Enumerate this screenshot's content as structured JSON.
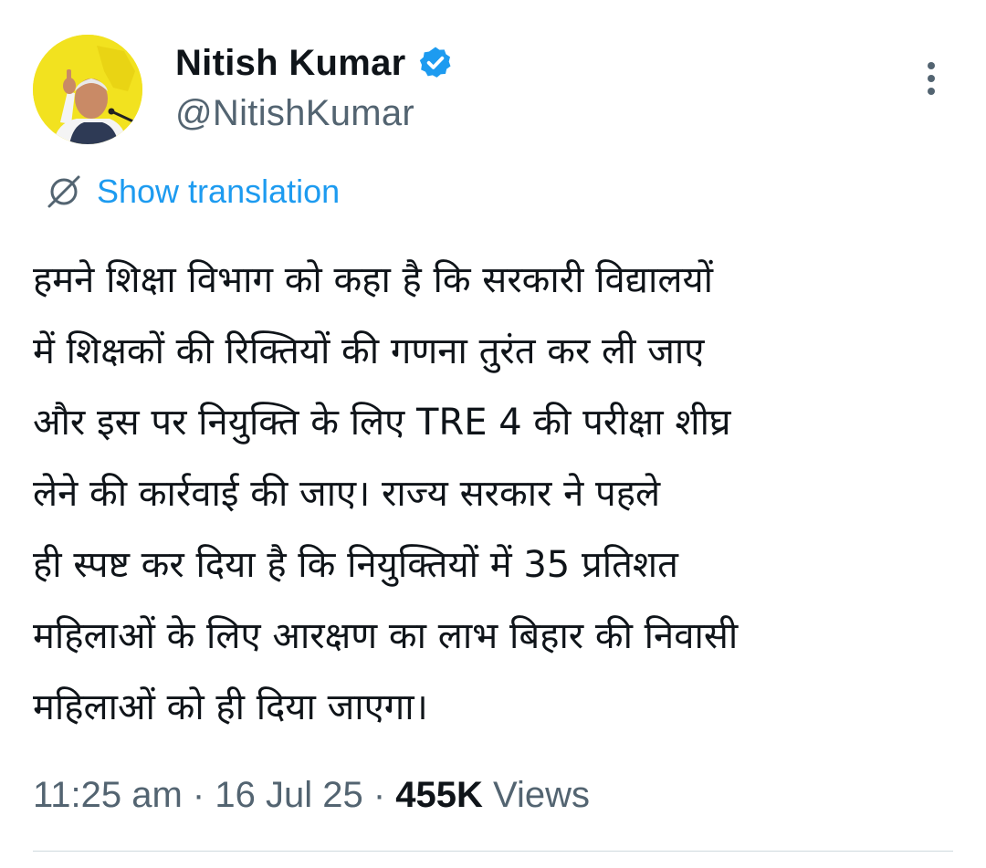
{
  "author": {
    "display_name": "Nitish Kumar",
    "handle": "@NitishKumar",
    "verified": true,
    "avatar_icon": "profile-photo",
    "avatar_bg": "#f2e21f"
  },
  "translate": {
    "label": "Show translation",
    "icon": "globe-translate-icon"
  },
  "tweet": {
    "lines": [
      "हमने शिक्षा विभाग को कहा है कि सरकारी विद्यालयों",
      "में शिक्षकों की रिक्तियों की गणना तुरंत कर ली जाए",
      "और इस पर नियुक्ति के लिए TRE 4 की परीक्षा शीघ्र",
      "लेने की कार्रवाई की जाए। राज्य सरकार ने पहले",
      "ही स्पष्ट कर दिया है कि नियुक्तियों में 35 प्रतिशत",
      "महिलाओं के लिए आरक्षण का लाभ बिहार की निवासी",
      "महिलाओं को ही दिया जाएगा।"
    ]
  },
  "meta": {
    "time": "11:25 am",
    "separator": " · ",
    "date": "16 Jul 25",
    "views_count": "455K",
    "views_label": "Views"
  },
  "colors": {
    "accent": "#1d9bf0",
    "secondary_text": "#536471",
    "primary_text": "#0f1419"
  }
}
